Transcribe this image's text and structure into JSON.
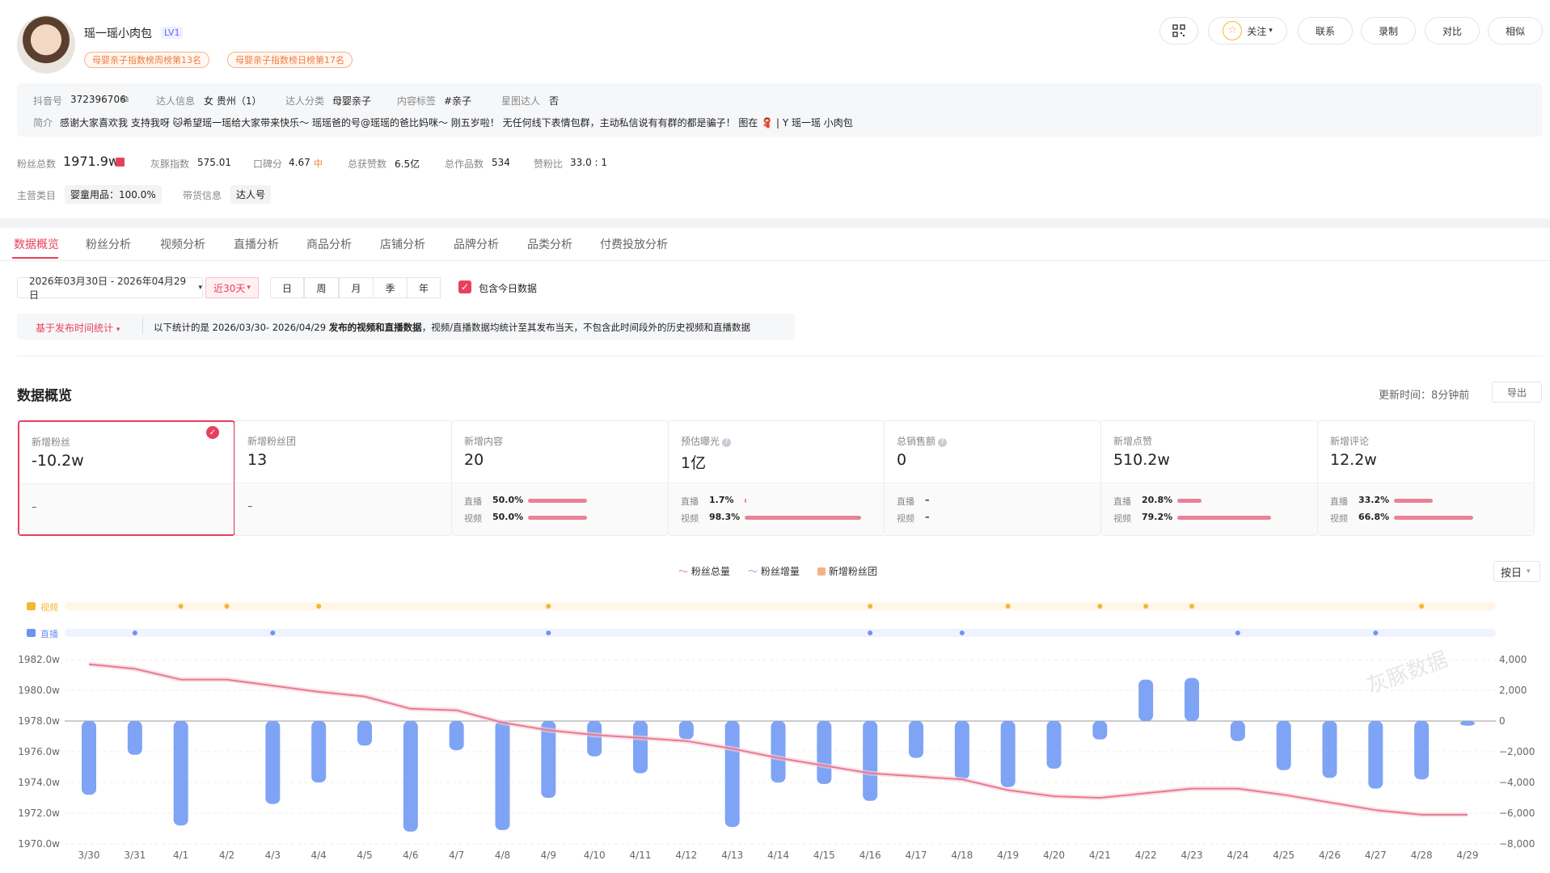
{
  "profile": {
    "name": "瑶一瑶小肉包",
    "level": "LV1",
    "ranks": [
      "母婴亲子指数榜周榜第13名",
      "母婴亲子指数榜日榜第17名"
    ],
    "douyin_id_label": "抖音号",
    "douyin_id": "372396706",
    "info_label": "达人信息",
    "info": "女 贵州（1）",
    "category_label": "达人分类",
    "category": "母婴亲子",
    "content_tag_label": "内容标签",
    "content_tag": "#亲子",
    "star_label": "星图达人",
    "star": "否",
    "bio_label": "简介",
    "bio": "感谢大家喜欢我 支持我呀 🐱希望瑶一瑶给大家带来快乐～ 瑶瑶爸的号@瑶瑶的爸比妈咪～ 刚五岁啦！ 无任何线下表情包群，主动私信说有有群的都是骗子！ 图在 🧣 | Y 瑶一瑶 小肉包"
  },
  "header_buttons": {
    "follow": "关注",
    "contact": "联系",
    "record": "录制",
    "compare": "对比",
    "similar": "相似"
  },
  "stats": {
    "fans_label": "粉丝总数",
    "fans": "1971.9w",
    "index_label": "灰豚指数",
    "index": "575.01",
    "rep_label": "口碑分",
    "rep": "4.67",
    "rep_badge": "中",
    "likes_label": "总获赞数",
    "likes": "6.5亿",
    "works_label": "总作品数",
    "works": "534",
    "ratio_label": "赞粉比",
    "ratio": "33.0 : 1",
    "main_cat_label": "主营类目",
    "main_cat": "婴童用品：100.0%",
    "goods_label": "带货信息",
    "goods": "达人号"
  },
  "tabs": [
    "数据概览",
    "粉丝分析",
    "视频分析",
    "直播分析",
    "商品分析",
    "店铺分析",
    "品牌分析",
    "品类分析",
    "付费投放分析"
  ],
  "filters": {
    "date_range": "2026年03月30日 - 2026年04月29日",
    "periods": [
      "近30天",
      "日",
      "周",
      "月",
      "季",
      "年"
    ],
    "include_today": "包含今日数据",
    "basis": "基于发布时间统计",
    "note_prefix": "以下统计的是 2026/03/30- 2026/04/29 ",
    "note_bold": "发布的视频和直播数据",
    "note_suffix": "，视频/直播数据均统计至其发布当天，不包含此时间段外的历史视频和直播数据"
  },
  "overview": {
    "title": "数据概览",
    "update_time": "更新时间：8分钟前",
    "export": "导出",
    "cards": [
      {
        "title": "新增粉丝",
        "value": "-10.2w",
        "foot": "–"
      },
      {
        "title": "新增粉丝团",
        "value": "13",
        "foot": "–"
      },
      {
        "title": "新增内容",
        "value": "20",
        "live_label": "直播",
        "live": "50.0%",
        "video_label": "视频",
        "video": "50.0%",
        "live_frac": 0.5,
        "video_frac": 0.5
      },
      {
        "title": "预估曝光",
        "value": "1亿",
        "live_label": "直播",
        "live": "1.7%",
        "video_label": "视频",
        "video": "98.3%",
        "live_frac": 0.017,
        "video_frac": 0.983
      },
      {
        "title": "总销售额",
        "value": "0",
        "live_label": "直播",
        "live": "–",
        "video_label": "视频",
        "video": "–"
      },
      {
        "title": "新增点赞",
        "value": "510.2w",
        "live_label": "直播",
        "live": "20.8%",
        "video_label": "视频",
        "video": "79.2%",
        "live_frac": 0.208,
        "video_frac": 0.792
      },
      {
        "title": "新增评论",
        "value": "12.2w",
        "live_label": "直播",
        "live": "33.2%",
        "video_label": "视频",
        "video": "66.8%",
        "live_frac": 0.332,
        "video_frac": 0.668
      }
    ]
  },
  "chart_legend": {
    "total": "粉丝总量",
    "delta": "粉丝增量",
    "club": "新增粉丝团",
    "by_day": "按日",
    "video": "视频",
    "live": "直播"
  },
  "watermark": "灰豚数据",
  "chart_data": {
    "type": "bar",
    "categories": [
      "3/30",
      "3/31",
      "4/1",
      "4/2",
      "4/3",
      "4/4",
      "4/5",
      "4/6",
      "4/7",
      "4/8",
      "4/9",
      "4/10",
      "4/11",
      "4/12",
      "4/13",
      "4/14",
      "4/15",
      "4/16",
      "4/17",
      "4/18",
      "4/19",
      "4/20",
      "4/21",
      "4/22",
      "4/23",
      "4/24",
      "4/25",
      "4/26",
      "4/27",
      "4/28",
      "4/29"
    ],
    "series": [
      {
        "name": "粉丝总量",
        "type": "line",
        "axis": "left",
        "values": [
          1981.7,
          1981.4,
          1980.7,
          1980.7,
          1980.3,
          1979.9,
          1979.6,
          1978.8,
          1978.7,
          1977.9,
          1977.4,
          1977.1,
          1976.9,
          1976.7,
          1976.2,
          1975.6,
          1975.1,
          1974.6,
          1974.4,
          1974.2,
          1973.5,
          1973.1,
          1973.0,
          1973.3,
          1973.6,
          1973.6,
          1973.2,
          1972.7,
          1972.2,
          1971.9,
          1971.9
        ]
      },
      {
        "name": "粉丝增量",
        "type": "bar",
        "axis": "right",
        "values": [
          -4800,
          -2200,
          -6800,
          0,
          -5400,
          -4000,
          -1600,
          -7200,
          -1900,
          -7100,
          -5000,
          -2300,
          -3400,
          -1200,
          -6900,
          -4000,
          -4100,
          -5200,
          -2400,
          -3800,
          -4300,
          -3100,
          -1200,
          2700,
          2800,
          -1300,
          -3200,
          -3700,
          -4400,
          -3800,
          -300
        ]
      },
      {
        "name": "新增粉丝团",
        "type": "bar",
        "axis": "right",
        "values": []
      }
    ],
    "video_events": [
      "4/1",
      "4/2",
      "4/4",
      "4/9",
      "4/16",
      "4/19",
      "4/21",
      "4/22",
      "4/23",
      "4/28"
    ],
    "live_events": [
      "3/31",
      "4/3",
      "4/9",
      "4/16",
      "4/18",
      "4/24",
      "4/27"
    ],
    "y_left": {
      "ticks": [
        "1982.0w",
        "1980.0w",
        "1978.0w",
        "1976.0w",
        "1974.0w",
        "1972.0w",
        "1970.0w"
      ],
      "range": [
        1970,
        1982
      ]
    },
    "y_right": {
      "ticks": [
        "4,000",
        "2,000",
        "0",
        "−2,000",
        "−4,000",
        "−6,000",
        "−8,000"
      ],
      "range": [
        -8000,
        4000
      ]
    },
    "legend_position": "top-center",
    "colors": {
      "line": "#e97a93",
      "bar": "#7fa4f6",
      "video": "#f5b72d",
      "live": "#6f93f0"
    }
  }
}
